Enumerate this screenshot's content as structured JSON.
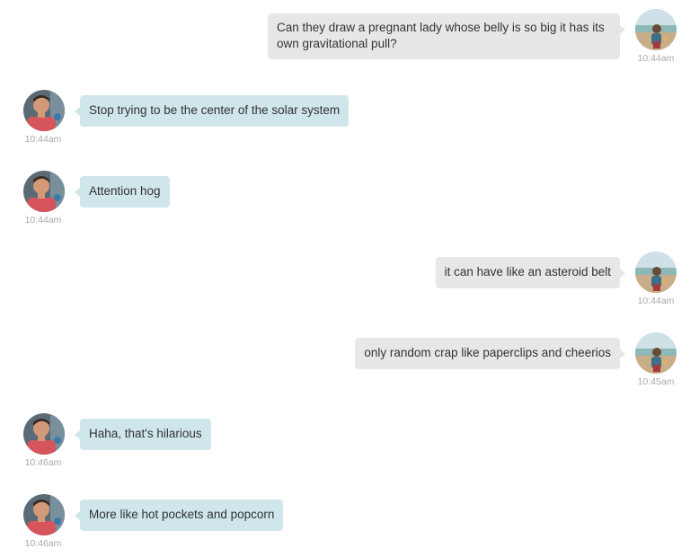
{
  "messages": [
    {
      "side": "outgoing",
      "text": "Can they draw a pregnant lady whose belly is so big it has its own gravitational pull?",
      "time": "10:44am"
    },
    {
      "side": "incoming",
      "text": "Stop trying to be the center of the solar system",
      "time": "10:44am"
    },
    {
      "side": "incoming",
      "text": "Attention hog",
      "time": "10:44am"
    },
    {
      "side": "outgoing",
      "text": "it can have like an asteroid belt",
      "time": "10:44am"
    },
    {
      "side": "outgoing",
      "text": "only random crap like paperclips and cheerios",
      "time": "10:45am"
    },
    {
      "side": "incoming",
      "text": "Haha, that's hilarious",
      "time": "10:46am"
    },
    {
      "side": "incoming",
      "text": "More like hot pockets and popcorn",
      "time": "10:46am"
    }
  ],
  "colors": {
    "incoming_bubble": "#cfe6eb",
    "outgoing_bubble": "#e7e7e7",
    "text": "#333333",
    "timestamp": "#a9a9a9"
  },
  "icons": {
    "incoming_avatar": "user-photo-avatar",
    "outgoing_avatar": "beach-photo-avatar"
  }
}
